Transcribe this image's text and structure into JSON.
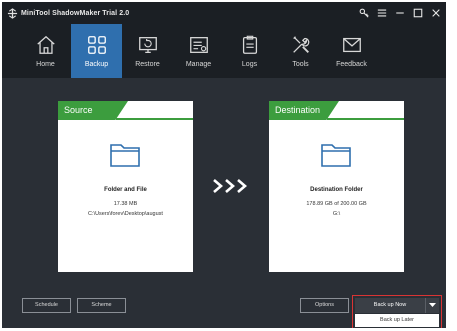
{
  "window": {
    "title": "MiniTool ShadowMaker Trial 2.0",
    "logo_icon": "shadowmaker-logo-icon",
    "controls": [
      {
        "name": "key-icon"
      },
      {
        "name": "menu-icon"
      },
      {
        "name": "minimize-icon"
      },
      {
        "name": "maximize-icon"
      },
      {
        "name": "close-icon"
      }
    ]
  },
  "nav": {
    "active": "Backup",
    "accent_color": "#2f6fae",
    "items": [
      {
        "label": "Home",
        "icon": "home-icon"
      },
      {
        "label": "Backup",
        "icon": "backup-grid-icon"
      },
      {
        "label": "Restore",
        "icon": "restore-monitor-icon"
      },
      {
        "label": "Manage",
        "icon": "manage-list-icon"
      },
      {
        "label": "Logs",
        "icon": "logs-clipboard-icon"
      },
      {
        "label": "Tools",
        "icon": "tools-wrench-icon"
      },
      {
        "label": "Feedback",
        "icon": "feedback-mail-icon"
      }
    ]
  },
  "source": {
    "tab_label": "Source",
    "title": "Folder and File",
    "size": "17.38 MB",
    "path": "C:\\Users\\forev\\Desktop\\august",
    "icon": "folder-icon",
    "tab_color": "#3c9d3e"
  },
  "transfer": {
    "icon": "triple-chevron-right-icon"
  },
  "destination": {
    "tab_label": "Destination",
    "title": "Destination Folder",
    "capacity": "178.89 GB of 200.00 GB",
    "drive": "G:\\",
    "icon": "folder-icon",
    "tab_color": "#3c9d3e"
  },
  "footer": {
    "schedule_label": "Schedule",
    "scheme_label": "Scheme",
    "options_label": "Options",
    "backup_now_label": "Back up Now",
    "backup_later_label": "Back up Later",
    "highlight_color": "#d93434"
  }
}
